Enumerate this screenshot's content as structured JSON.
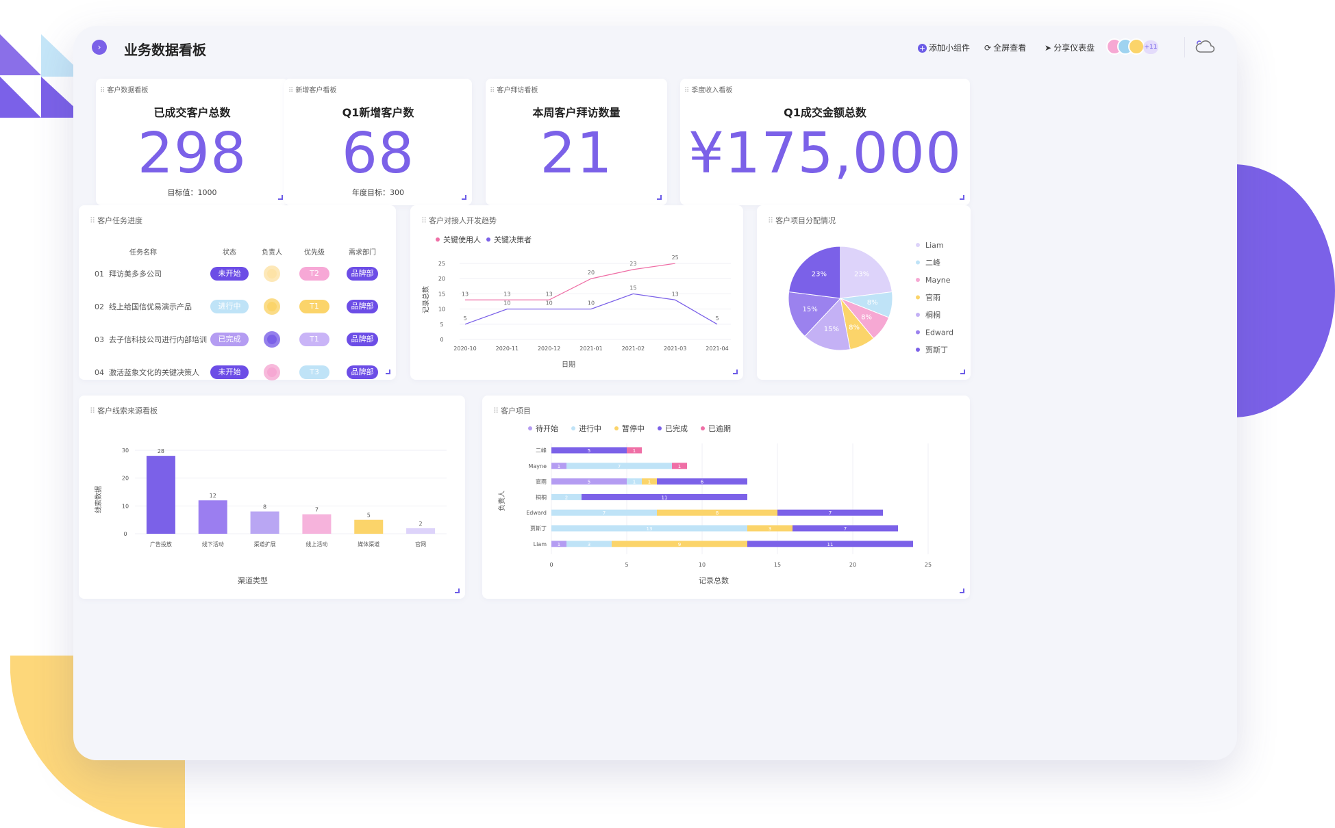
{
  "header": {
    "title": "业务数据看板",
    "add_widget": "添加小组件",
    "fullscreen": "全屏查看",
    "share": "分享仪表盘",
    "avatar_more": "+11"
  },
  "kpis": [
    {
      "board": "客户数据看板",
      "title": "已成交客户总数",
      "value": "298",
      "sub": "目标值：1000"
    },
    {
      "board": "新增客户看板",
      "title": "Q1新增客户数",
      "value": "68",
      "sub": "年度目标：300"
    },
    {
      "board": "客户拜访看板",
      "title": "本周客户拜访数量",
      "value": "21",
      "sub": ""
    },
    {
      "board": "季度收入看板",
      "title": "Q1成交金额总数",
      "value": "¥175,000",
      "sub": ""
    }
  ],
  "tasks": {
    "title": "客户任务进度",
    "columns": [
      "任务名称",
      "状态",
      "负责人",
      "优先级",
      "需求部门"
    ],
    "rows": [
      {
        "no": "01",
        "name": "拜访美多多公司",
        "status": "未开始",
        "status_color": "#6c4de6",
        "priority": "T2",
        "priority_color": "#f7a8d6",
        "dept": "品牌部"
      },
      {
        "no": "02",
        "name": "线上给国信优易演示产品",
        "status": "进行中",
        "status_color": "#bfe3f7",
        "priority": "T1",
        "priority_color": "#fbd46a",
        "dept": "品牌部"
      },
      {
        "no": "03",
        "name": "去子信科技公司进行内部培训",
        "status": "已完成",
        "status_color": "#b49cf2",
        "priority": "T1",
        "priority_color": "#c9b4f7",
        "dept": "品牌部"
      },
      {
        "no": "04",
        "name": "激活蓝象文化的关键决策人",
        "status": "未开始",
        "status_color": "#6c4de6",
        "priority": "T3",
        "priority_color": "#bfe3f7",
        "dept": "品牌部"
      }
    ]
  },
  "trend": {
    "title": "客户对接人开发趋势",
    "xlabel": "日期",
    "ylabel": "记录总数",
    "legend": [
      "关键使用人",
      "关键决策者"
    ]
  },
  "pie": {
    "title": "客户项目分配情况"
  },
  "leads": {
    "title": "客户线索来源看板",
    "xlabel": "渠道类型",
    "ylabel": "线索数据"
  },
  "projects": {
    "title": "客户项目",
    "xlabel": "记录总数",
    "ylabel": "负责人",
    "legend": [
      "待开始",
      "进行中",
      "暂停中",
      "已完成",
      "已逾期"
    ]
  },
  "colors": {
    "accent": "#7b61e8",
    "pink": "#ef6fa6",
    "light_blue": "#bfe3f7",
    "yellow": "#fbd46a",
    "lavender": "#b49cf2"
  },
  "chart_data": [
    {
      "type": "line",
      "x": [
        "2020-10",
        "2020-11",
        "2020-12",
        "2021-01",
        "2021-02",
        "2021-03",
        "2021-04"
      ],
      "ylim": [
        0,
        25
      ],
      "yticks": [
        0,
        5,
        10,
        15,
        20,
        25
      ],
      "series": [
        {
          "name": "关键使用人",
          "color": "#ef6fa6",
          "values": [
            13,
            13,
            13,
            20,
            23,
            25,
            null
          ]
        },
        {
          "name": "关键决策者",
          "color": "#7b61e8",
          "values": [
            5,
            10,
            10,
            10,
            15,
            13,
            5
          ]
        }
      ],
      "xlabel": "日期",
      "ylabel": "记录总数"
    },
    {
      "type": "pie",
      "labels": [
        "Liam",
        "二峰",
        "Mayne",
        "官雨",
        "桐桐",
        "Edward",
        "贾斯丁"
      ],
      "colors": [
        "#ddd3fa",
        "#bfe3f7",
        "#f6a8d3",
        "#fbd46a",
        "#c4b1f5",
        "#9b82ee",
        "#7b61e8"
      ],
      "values": [
        23,
        8,
        8,
        8,
        15,
        15,
        23
      ],
      "value_labels": [
        "23%",
        "8%",
        "8%",
        "8%",
        "15%",
        "15%",
        "23%"
      ]
    },
    {
      "type": "bar",
      "categories": [
        "广告投放",
        "线下活动",
        "渠道扩展",
        "线上活动",
        "媒体渠道",
        "官网"
      ],
      "values": [
        28,
        12,
        8,
        7,
        5,
        2
      ],
      "colors": [
        "#7b61e8",
        "#9b7ef0",
        "#b9a6f3",
        "#f6b3dc",
        "#fbd46a",
        "#ddd3fa"
      ],
      "ylim": [
        0,
        30
      ],
      "yticks": [
        0,
        10,
        20,
        30
      ],
      "xlabel": "渠道类型",
      "ylabel": "线索数据"
    },
    {
      "type": "bar",
      "orientation": "horizontal",
      "stacked": true,
      "categories": [
        "二峰",
        "Mayne",
        "官雨",
        "桐桐",
        "Edward",
        "贾斯丁",
        "Liam"
      ],
      "xlim": [
        0,
        25
      ],
      "xticks": [
        0,
        5,
        10,
        15,
        20,
        25
      ],
      "series": [
        {
          "name": "待开始",
          "color": "#b49cf2",
          "values": [
            0,
            1,
            5,
            0,
            0,
            0,
            1
          ]
        },
        {
          "name": "进行中",
          "color": "#bfe3f7",
          "values": [
            0,
            7,
            1,
            2,
            7,
            13,
            3
          ]
        },
        {
          "name": "暂停中",
          "color": "#fbd46a",
          "values": [
            0,
            0,
            1,
            0,
            8,
            3,
            9
          ]
        },
        {
          "name": "已完成",
          "color": "#7b61e8",
          "values": [
            5,
            0,
            6,
            11,
            7,
            7,
            11
          ]
        },
        {
          "name": "已逾期",
          "color": "#ef6fa6",
          "values": [
            1,
            1,
            0,
            0,
            0,
            0,
            0
          ]
        }
      ],
      "xlabel": "记录总数",
      "ylabel": "负责人"
    }
  ]
}
